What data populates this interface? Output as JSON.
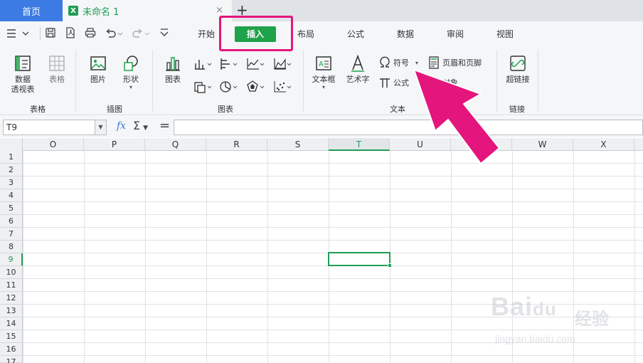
{
  "titlebar": {
    "home_tab": "首页",
    "doc_tab": "未命名 1",
    "doc_icon_letter": "X",
    "close_glyph": "×",
    "new_tab_glyph": "+"
  },
  "quick_access": [
    "menu-icon",
    "save-icon",
    "pdf-icon",
    "print-icon",
    "undo-icon",
    "redo-icon",
    "more-icon"
  ],
  "menu": {
    "tabs": [
      {
        "label": "开始",
        "active": false
      },
      {
        "label": "插入",
        "active": true
      },
      {
        "label": "布局",
        "active": false
      },
      {
        "label": "公式",
        "active": false
      },
      {
        "label": "数据",
        "active": false
      },
      {
        "label": "审阅",
        "active": false
      },
      {
        "label": "视图",
        "active": false
      }
    ]
  },
  "ribbon": {
    "pivot_label": "数据\n透视表",
    "table_label": "表格",
    "picture_label": "图片",
    "shape_label": "形状",
    "chart_label": "图表",
    "textbox_label": "文本框",
    "wordart_label": "艺术字",
    "symbol_label": "符号",
    "formula_label": "公式",
    "header_footer_label": "页眉和页脚",
    "object_label": "对象",
    "hyperlink_label": "超链接",
    "groups": {
      "table": "表格",
      "illustration": "插图",
      "chart": "图表",
      "text": "文本",
      "link": "链接"
    }
  },
  "formula_bar": {
    "name_box": "T9",
    "fx": "fx",
    "sigma": "Σ",
    "equals": "=",
    "formula": ""
  },
  "grid": {
    "columns": [
      "O",
      "P",
      "Q",
      "R",
      "S",
      "T",
      "U",
      "V",
      "W",
      "X"
    ],
    "active_column": "T",
    "rows": [
      "1",
      "2",
      "3",
      "4",
      "5",
      "6",
      "7",
      "8",
      "9",
      "10",
      "11",
      "12",
      "13",
      "14",
      "15",
      "16",
      "17"
    ],
    "active_row": "9"
  },
  "watermark": {
    "brand": "Bai",
    "brand_suffix": "du",
    "jingyan": "经验",
    "url": "jingyan.baidu.com"
  },
  "colors": {
    "accent_green": "#1ea24a",
    "home_blue": "#3c7be3",
    "annotation_pink": "#e4157c"
  }
}
